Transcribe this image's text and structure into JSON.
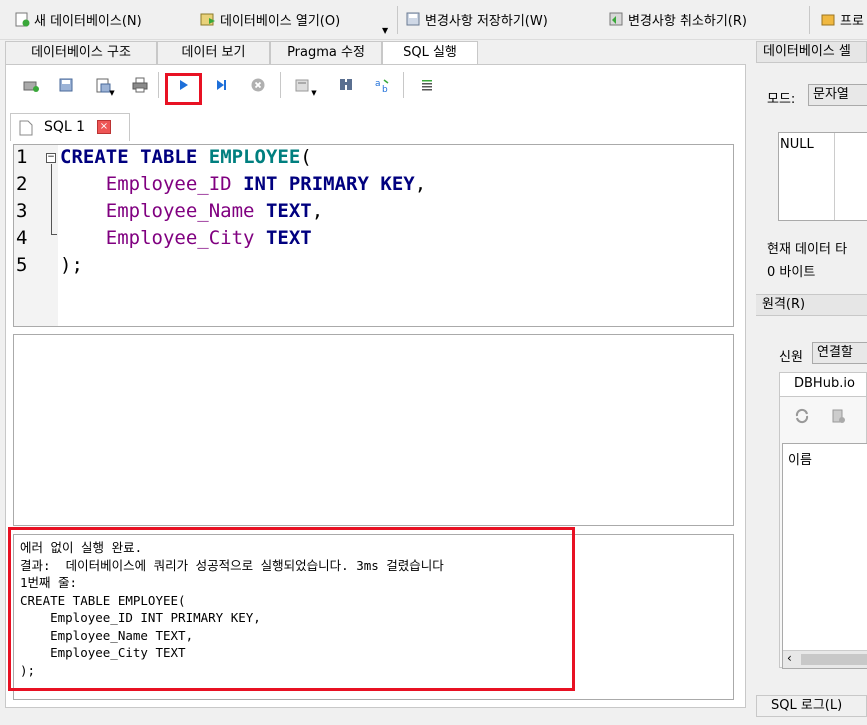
{
  "toolbar": {
    "new_db": "새 데이터베이스(N)",
    "open_db": "데이터베이스 열기(O)",
    "write_changes": "변경사항 저장하기(W)",
    "revert_changes": "변경사항 취소하기(R)",
    "project": "프로"
  },
  "tabs": [
    "데이터베이스 구조",
    "데이터 보기",
    "Pragma 수정",
    "SQL 실행"
  ],
  "sql_tab": {
    "label": "SQL 1"
  },
  "editor": {
    "line_numbers": [
      "1",
      "2",
      "3",
      "4",
      "5"
    ],
    "tokens": {
      "create": "CREATE",
      "table": "TABLE",
      "name": "EMPLOYEE",
      "open_paren": "(",
      "col1": "Employee_ID",
      "int": "INT",
      "primary": "PRIMARY",
      "key": "KEY",
      "comma": ",",
      "col2": "Employee_Name",
      "text": "TEXT",
      "col3": "Employee_City",
      "close": ");"
    }
  },
  "message": {
    "lines": [
      "에러 없이 실행 완료.",
      "결과:  데이터베이스에 쿼리가 성공적으로 실행되었습니다. 3ms 걸렸습니다",
      "1번째 줄:",
      "CREATE TABLE EMPLOYEE(",
      "    Employee_ID INT PRIMARY KEY,",
      "    Employee_Name TEXT,",
      "    Employee_City TEXT",
      ");"
    ]
  },
  "right_panel": {
    "title": "데이터베이스 셀",
    "mode_label": "모드:",
    "mode_value": "문자열",
    "cell_value": "NULL",
    "type_info": "현재 데이터 타",
    "size_info": "0 바이트",
    "remote_header": "원격(R)",
    "identity_label": "신원",
    "identity_value": "연결할",
    "dbhub_tab": "DBHub.io",
    "name_header": "이름",
    "sql_log": "SQL 로그(L)"
  },
  "colors": {
    "highlight": "#e81123",
    "run_blue": "#1e6fd9"
  }
}
